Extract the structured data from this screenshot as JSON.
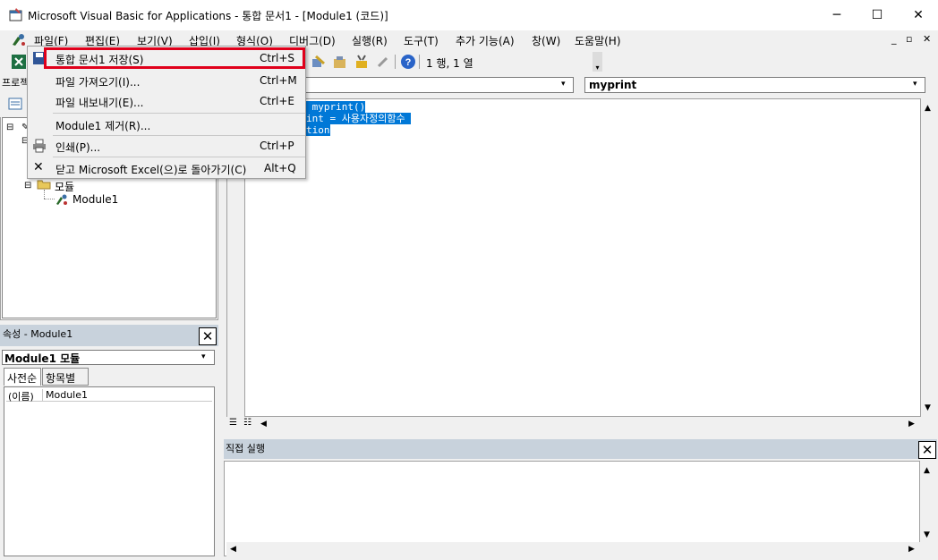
{
  "window": {
    "title": "Microsoft Visual Basic for Applications - 통합 문서1 - [Module1 (코드)]"
  },
  "menubar": {
    "items": [
      "파일(F)",
      "편집(E)",
      "보기(V)",
      "삽입(I)",
      "형식(O)",
      "디버그(D)",
      "실행(R)",
      "도구(T)",
      "추가 기능(A)",
      "창(W)",
      "도움말(H)"
    ]
  },
  "toolbar": {
    "position": "1 행, 1 열"
  },
  "file_menu": {
    "items": [
      {
        "label": "통합 문서1 저장(S)",
        "shortcut": "Ctrl+S",
        "icon": "save-icon"
      },
      {
        "label": "파일 가져오기(I)...",
        "shortcut": "Ctrl+M",
        "icon": ""
      },
      {
        "label": "파일 내보내기(E)...",
        "shortcut": "Ctrl+E",
        "icon": ""
      },
      {
        "label": "Module1 제거(R)...",
        "shortcut": "",
        "icon": ""
      },
      {
        "label": "인쇄(P)...",
        "shortcut": "Ctrl+P",
        "icon": "printer-icon"
      },
      {
        "label": "닫고 Microsoft Excel(으)로 돌아가기(C)",
        "shortcut": "Alt+Q",
        "icon": "close-x-icon"
      }
    ]
  },
  "project": {
    "head": "프로젝",
    "folder": "모듈",
    "module": "Module1"
  },
  "properties": {
    "caption": "속성 - Module1",
    "selected": "Module1 모듈",
    "tabs": [
      "사전순",
      "항목별"
    ],
    "row_key": "(이름)",
    "row_value": "Module1"
  },
  "code": {
    "combo_right": "myprint",
    "lines": [
      " myprint()",
      "int = 사용자정의함수 ",
      "tion"
    ]
  },
  "immediate": {
    "caption": "직접 실행"
  },
  "colors": {
    "highlight": "#0078d7",
    "menu_border": "#e0001b",
    "caption": "#c8d2dc"
  }
}
